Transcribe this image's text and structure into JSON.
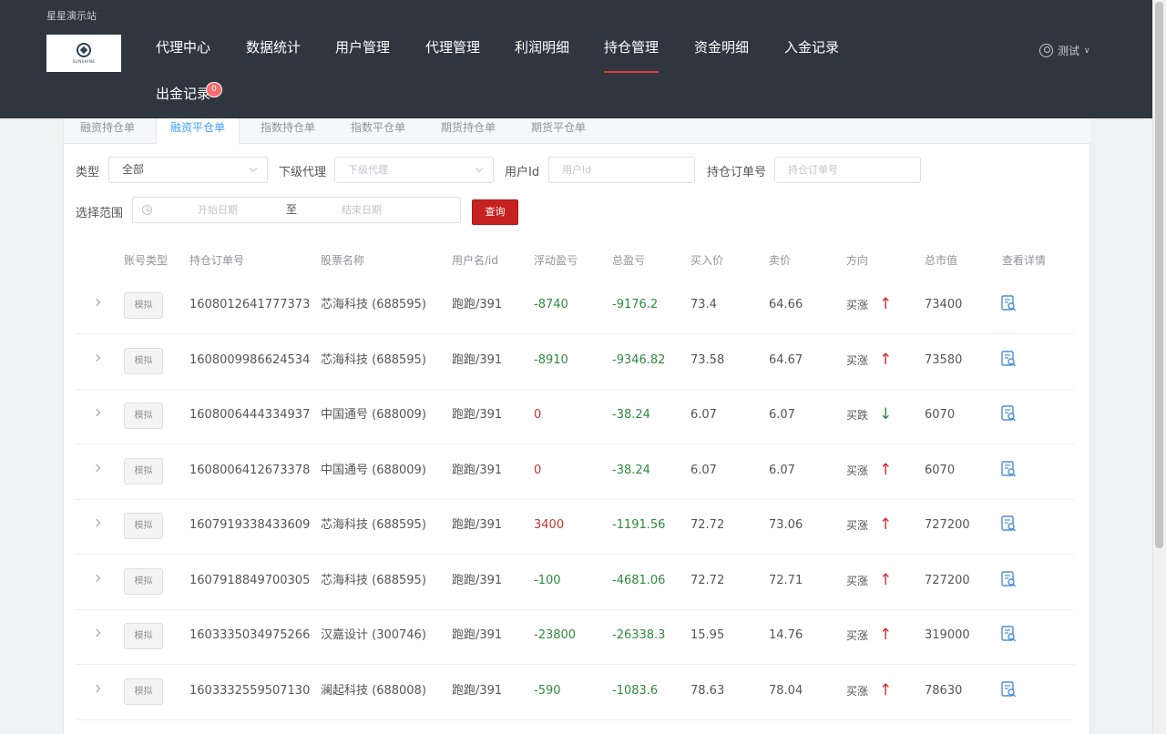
{
  "header": {
    "site_name": "星星演示站",
    "logo_text": "SUNSHINE",
    "nav": [
      {
        "label": "代理中心"
      },
      {
        "label": "数据统计"
      },
      {
        "label": "用户管理"
      },
      {
        "label": "代理管理"
      },
      {
        "label": "利润明细"
      },
      {
        "label": "持仓管理",
        "active": true
      },
      {
        "label": "资金明细"
      },
      {
        "label": "入金记录"
      },
      {
        "label": "出金记录"
      }
    ],
    "withdraw_badge": "0",
    "user_name": "测试"
  },
  "tabs": [
    "融资持仓单",
    "融资平仓单",
    "指数持仓单",
    "指数平仓单",
    "期货持仓单",
    "期货平仓单"
  ],
  "active_tab": "融资平仓单",
  "filters": {
    "type_label": "类型",
    "type_value": "全部",
    "agent_label": "下级代理",
    "agent_placeholder": "下级代理",
    "userid_label": "用户Id",
    "userid_placeholder": "用户Id",
    "order_label": "持仓订单号",
    "order_placeholder": "持仓订单号",
    "range_label": "选择范围",
    "start_placeholder": "开始日期",
    "range_sep": "至",
    "end_placeholder": "结束日期",
    "query_button": "查询"
  },
  "table": {
    "headers": [
      "账号类型",
      "持仓订单号",
      "股票名称",
      "用户名/id",
      "浮动盈亏",
      "总盈亏",
      "买入价",
      "卖价",
      "方向",
      "总市值",
      "查看详情"
    ],
    "rows": [
      {
        "account_type": "模拟",
        "order_no": "1608012641777373",
        "stock": "芯海科技 (688595)",
        "user": "跑跑/391",
        "float_pl": "-8740",
        "total_pl": "-9176.2",
        "buy_price": "73.4",
        "sell_price": "64.66",
        "direction": "买涨",
        "dir_arrow": "up",
        "market_value": "73400"
      },
      {
        "account_type": "模拟",
        "order_no": "1608009986624534",
        "stock": "芯海科技 (688595)",
        "user": "跑跑/391",
        "float_pl": "-8910",
        "total_pl": "-9346.82",
        "buy_price": "73.58",
        "sell_price": "64.67",
        "direction": "买涨",
        "dir_arrow": "up",
        "market_value": "73580"
      },
      {
        "account_type": "模拟",
        "order_no": "1608006444334937",
        "stock": "中国通号 (688009)",
        "user": "跑跑/391",
        "float_pl": "0",
        "total_pl": "-38.24",
        "buy_price": "6.07",
        "sell_price": "6.07",
        "direction": "买跌",
        "dir_arrow": "down",
        "market_value": "6070"
      },
      {
        "account_type": "模拟",
        "order_no": "1608006412673378",
        "stock": "中国通号 (688009)",
        "user": "跑跑/391",
        "float_pl": "0",
        "total_pl": "-38.24",
        "buy_price": "6.07",
        "sell_price": "6.07",
        "direction": "买涨",
        "dir_arrow": "up",
        "market_value": "6070"
      },
      {
        "account_type": "模拟",
        "order_no": "1607919338433609",
        "stock": "芯海科技 (688595)",
        "user": "跑跑/391",
        "float_pl": "3400",
        "total_pl": "-1191.56",
        "buy_price": "72.72",
        "sell_price": "73.06",
        "direction": "买涨",
        "dir_arrow": "up",
        "market_value": "727200"
      },
      {
        "account_type": "模拟",
        "order_no": "1607918849700305",
        "stock": "芯海科技 (688595)",
        "user": "跑跑/391",
        "float_pl": "-100",
        "total_pl": "-4681.06",
        "buy_price": "72.72",
        "sell_price": "72.71",
        "direction": "买涨",
        "dir_arrow": "up",
        "market_value": "727200"
      },
      {
        "account_type": "模拟",
        "order_no": "1603335034975266",
        "stock": "汉嘉设计 (300746)",
        "user": "跑跑/391",
        "float_pl": "-23800",
        "total_pl": "-26338.3",
        "buy_price": "15.95",
        "sell_price": "14.76",
        "direction": "买涨",
        "dir_arrow": "up",
        "market_value": "319000"
      },
      {
        "account_type": "模拟",
        "order_no": "1603332559507130",
        "stock": "澜起科技 (688008)",
        "user": "跑跑/391",
        "float_pl": "-590",
        "total_pl": "-1083.6",
        "buy_price": "78.63",
        "sell_price": "78.04",
        "direction": "买涨",
        "dir_arrow": "up",
        "market_value": "78630"
      }
    ]
  },
  "colors": {
    "header_bg": "#2f3640",
    "accent_red": "#c62121",
    "loss_green": "#2e8b3e",
    "profit_red": "#c0392b",
    "tab_active": "#409eff"
  }
}
